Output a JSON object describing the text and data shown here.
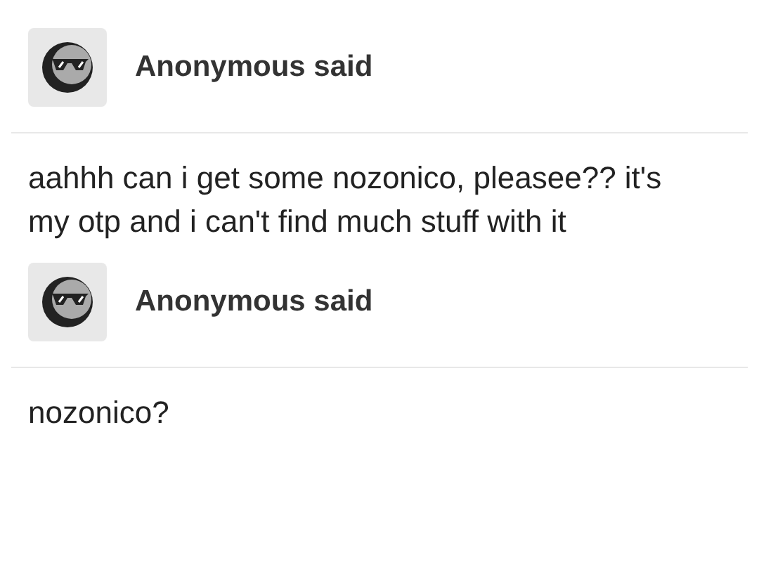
{
  "posts": [
    {
      "author": "Anonymous said",
      "body": "aahhh can i get some nozonico, pleasee?? it's my otp and i can't find much stuff with it"
    },
    {
      "author": "Anonymous said",
      "body": "nozonico?"
    }
  ]
}
